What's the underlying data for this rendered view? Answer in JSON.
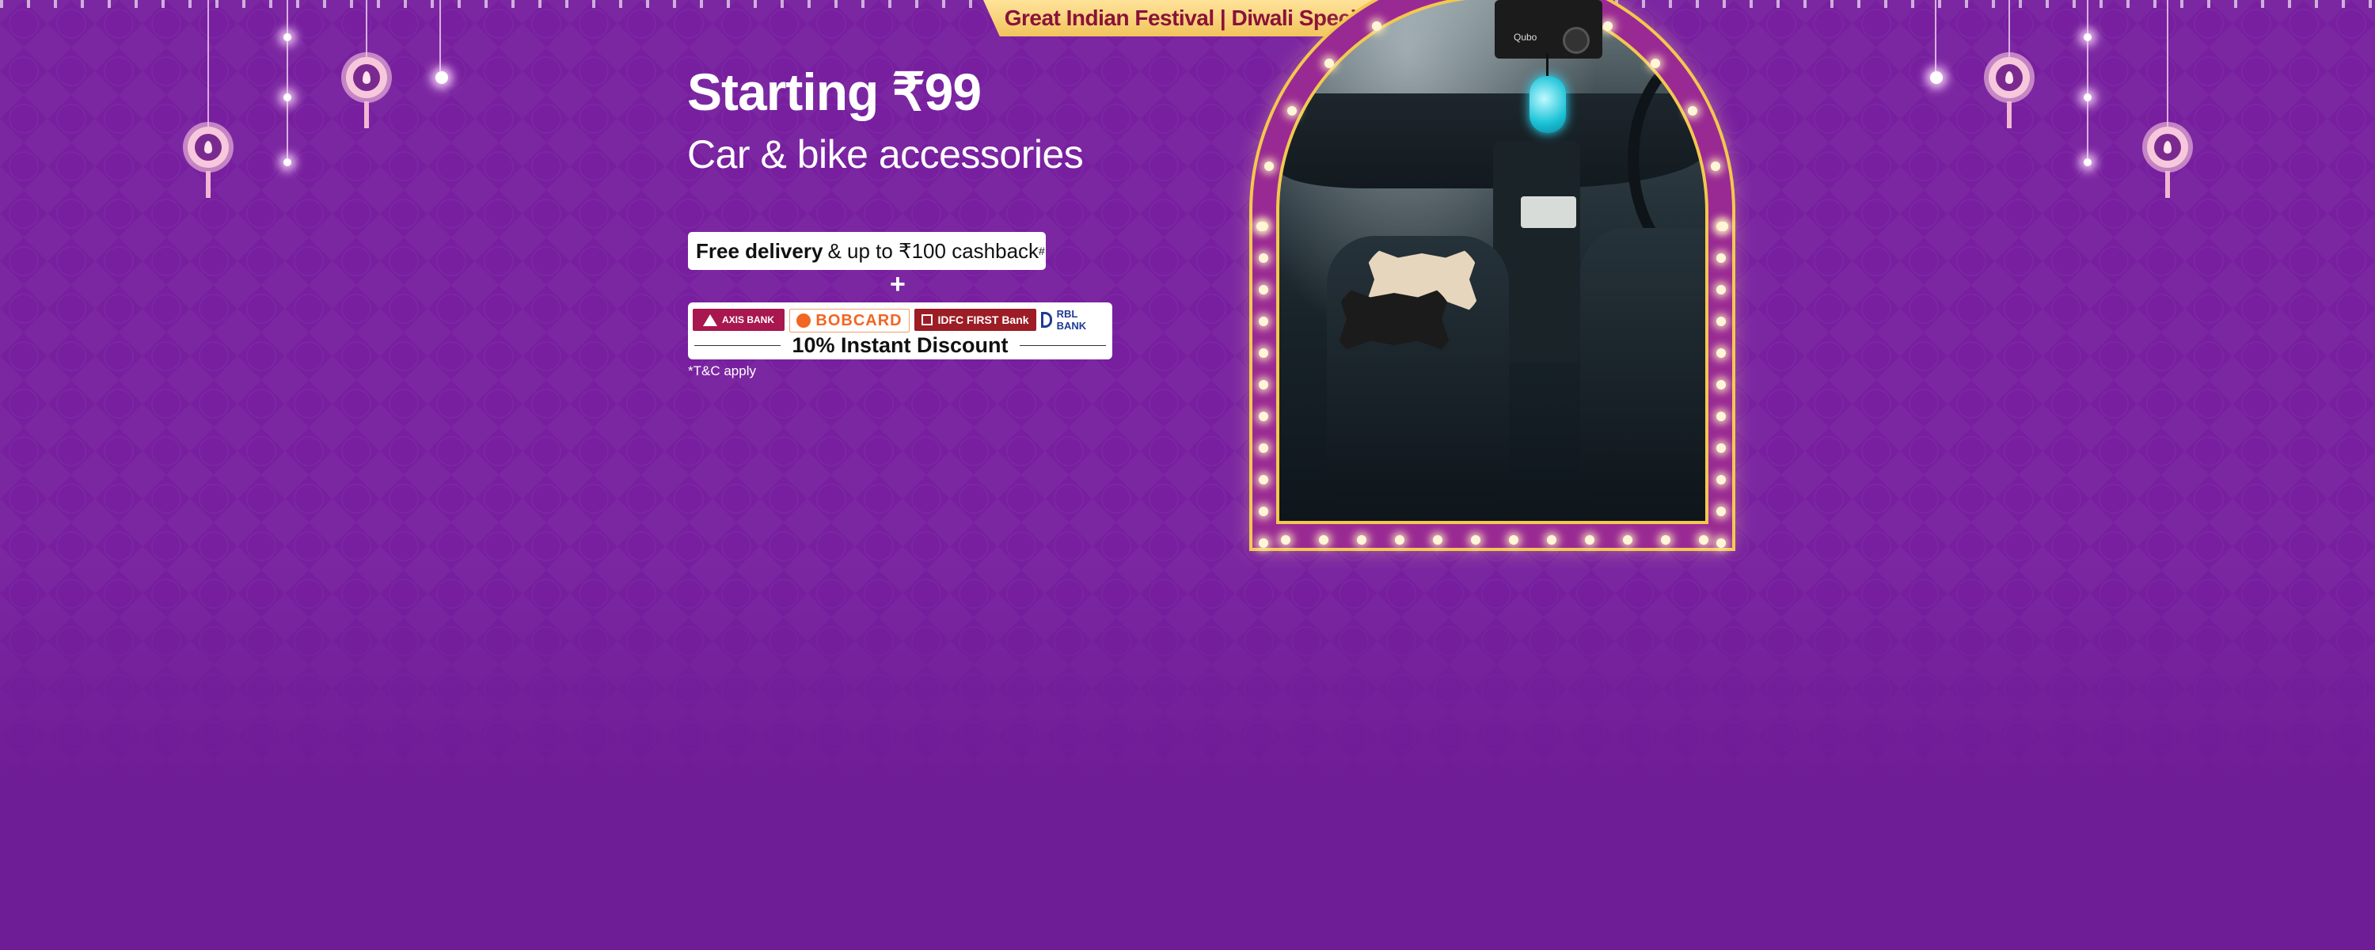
{
  "banner": {
    "festival_label": "Great Indian Festival | Diwali Special",
    "headline": "Starting ₹99",
    "subheadline": "Car & bike accessories",
    "delivery_bold": "Free delivery",
    "delivery_rest": "& up to ₹100 cashback",
    "delivery_mark": "#",
    "plus": "+",
    "banks": [
      {
        "name": "AXIS BANK",
        "icon": "axis-bank-logo"
      },
      {
        "name": "BOBCARD",
        "icon": "bobcard-logo"
      },
      {
        "name": "IDFC FIRST Bank",
        "icon": "idfc-first-bank-logo"
      },
      {
        "name": "RBL BANK",
        "icon": "rbl-bank-logo"
      }
    ],
    "discount": "10% Instant Discount",
    "terms": "*T&C apply"
  },
  "product_image": {
    "description_icon": "car-interior-accessories-image",
    "device_text": "Qubo"
  },
  "colors": {
    "background": "#6f1c97",
    "ribbon": "#f2c45c",
    "ribbon_text": "#8a1239",
    "arch_border": "#f3c84e"
  }
}
